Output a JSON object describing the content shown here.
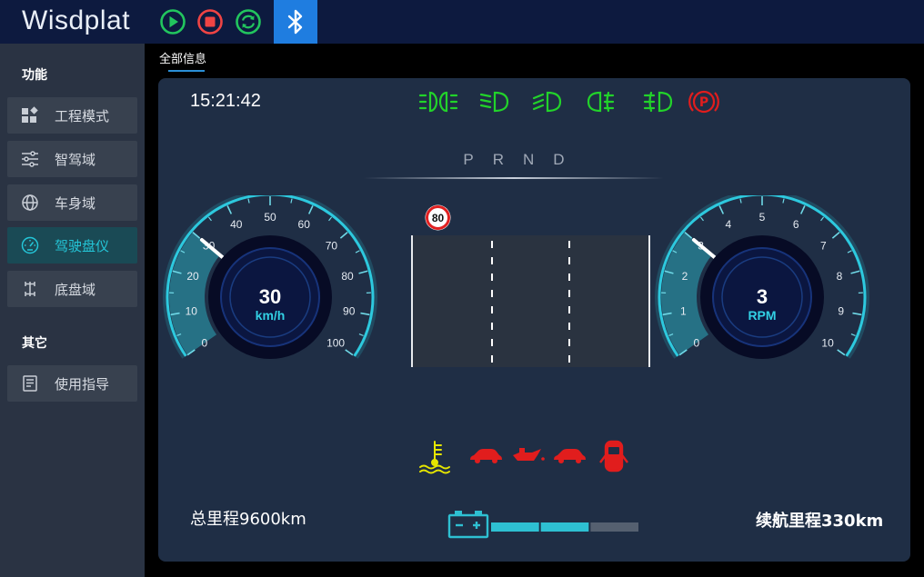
{
  "app": {
    "title": "Wisdplat"
  },
  "toolbar": {
    "buttons": [
      {
        "name": "play",
        "icon": "play-icon",
        "color": "#22c55e"
      },
      {
        "name": "stop",
        "icon": "stop-icon",
        "color": "#ef4444"
      },
      {
        "name": "refresh",
        "icon": "refresh-icon",
        "color": "#22c55e"
      },
      {
        "name": "bluetooth",
        "icon": "bluetooth-icon",
        "color": "#1f7de0"
      }
    ]
  },
  "sidebar": {
    "section_function": "功能",
    "items": [
      {
        "label": "工程模式",
        "icon": "grid-icon",
        "active": false
      },
      {
        "label": "智驾域",
        "icon": "sliders-icon",
        "active": false
      },
      {
        "label": "车身域",
        "icon": "globe-icon",
        "active": false
      },
      {
        "label": "驾驶盘仪",
        "icon": "gauge-icon",
        "active": true
      },
      {
        "label": "底盘域",
        "icon": "chassis-icon",
        "active": false
      }
    ],
    "section_other": "其它",
    "other_items": [
      {
        "label": "使用指导",
        "icon": "document-icon",
        "active": false
      }
    ]
  },
  "tabs": [
    {
      "label": "全部信息",
      "active": true
    }
  ],
  "dashboard": {
    "time": "15:21:42",
    "gear": "PRND",
    "speed_limit": "80",
    "odometer": "总里程9600km",
    "range": "续航里程330km",
    "battery_level": 0.5,
    "top_indicators": [
      {
        "icon": "position-lights-icon",
        "color": "#22d32a"
      },
      {
        "icon": "low-beam-icon",
        "color": "#22d32a"
      },
      {
        "icon": "high-beam-icon",
        "color": "#22d32a"
      },
      {
        "icon": "fog-light-icon",
        "color": "#22d32a"
      },
      {
        "icon": "rear-fog-light-icon",
        "color": "#22d32a"
      },
      {
        "icon": "parking-brake-icon",
        "color": "#e11d1d"
      }
    ],
    "bottom_indicators": [
      {
        "icon": "coolant-temperature-icon",
        "color": "#e5e500"
      },
      {
        "icon": "car-warning-icon",
        "color": "#e11d1d"
      },
      {
        "icon": "oil-pressure-icon",
        "color": "#e11d1d"
      },
      {
        "icon": "car-warning-icon",
        "color": "#e11d1d"
      },
      {
        "icon": "door-open-icon",
        "color": "#e11d1d"
      }
    ],
    "speedometer": {
      "value": "30",
      "value_num": 30,
      "unit": "km/h",
      "min": 0,
      "max": 100,
      "ticks": [
        "0",
        "10",
        "20",
        "30",
        "40",
        "50",
        "60",
        "70",
        "80",
        "90",
        "100"
      ]
    },
    "tachometer": {
      "value": "3",
      "value_num": 3,
      "unit": "RPM",
      "min": 0,
      "max": 10,
      "ticks": [
        "0",
        "1",
        "2",
        "3",
        "4",
        "5",
        "6",
        "7",
        "8",
        "9",
        "10"
      ]
    }
  }
}
